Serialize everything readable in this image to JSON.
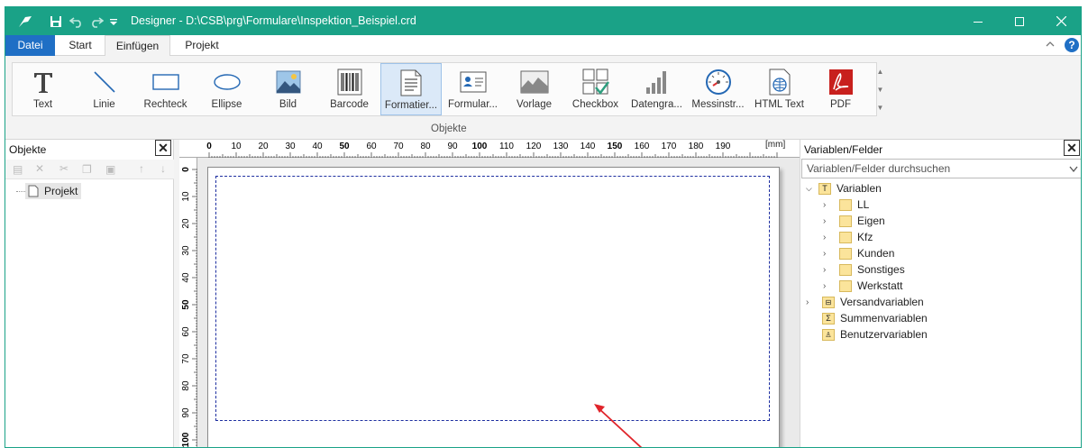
{
  "window": {
    "title": "Designer - D:\\CSB\\prg\\Formulare\\Inspektion_Beispiel.crd"
  },
  "menu": {
    "tabs": [
      "Datei",
      "Start",
      "Einfügen",
      "Projekt"
    ]
  },
  "ribbon": {
    "group_label": "Objekte",
    "buttons": [
      "Text",
      "Linie",
      "Rechteck",
      "Ellipse",
      "Bild",
      "Barcode",
      "Formatier...",
      "Formular...",
      "Vorlage",
      "Checkbox",
      "Datengra...",
      "Messinstr...",
      "HTML Text",
      "PDF"
    ],
    "selected": "Formatier..."
  },
  "objects_panel": {
    "title": "Objekte",
    "tree": [
      {
        "label": "Projekt"
      }
    ]
  },
  "ruler": {
    "unit": "[mm]",
    "h_ticks": [
      "0",
      "10",
      "20",
      "30",
      "40",
      "50",
      "60",
      "70",
      "80",
      "90",
      "100",
      "110",
      "120",
      "130",
      "140",
      "150",
      "160",
      "170",
      "180",
      "190"
    ],
    "v_ticks": [
      "0",
      "10",
      "20",
      "30",
      "40",
      "50",
      "60",
      "70",
      "80",
      "90",
      "100"
    ]
  },
  "variables_panel": {
    "title": "Variablen/Felder",
    "search_placeholder": "Variablen/Felder durchsuchen",
    "root": "Variablen",
    "children": [
      "LL",
      "Eigen",
      "Kfz",
      "Kunden",
      "Sonstiges",
      "Werkstatt"
    ],
    "others": [
      "Versandvariablen",
      "Summenvariablen",
      "Benutzervariablen"
    ]
  },
  "colors": {
    "titlebar": "#1aa287",
    "file_tab": "#1f6fc5",
    "arrow": "#e0242a"
  }
}
